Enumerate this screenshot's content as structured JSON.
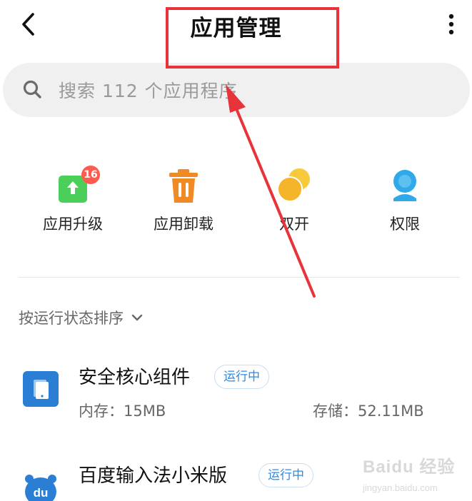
{
  "header": {
    "title": "应用管理"
  },
  "search": {
    "placeholder": "搜索 112 个应用程序"
  },
  "quick_actions": [
    {
      "label": "应用升级",
      "icon": "upgrade-icon",
      "badge": "16",
      "color": "#4ccf5a"
    },
    {
      "label": "应用卸载",
      "icon": "trash-icon",
      "color": "#f08a24"
    },
    {
      "label": "双开",
      "icon": "dual-app-icon",
      "color": "#f5b52a"
    },
    {
      "label": "权限",
      "icon": "permission-icon",
      "color": "#2fa9ea"
    }
  ],
  "sort": {
    "label": "按运行状态排序"
  },
  "apps": [
    {
      "name": "安全核心组件",
      "status": "运行中",
      "memory": "内存：15MB",
      "storage": "存储：52.11MB",
      "icon": "security-core-icon"
    },
    {
      "name": "百度输入法小米版",
      "status": "运行中",
      "icon": "baidu-input-icon"
    }
  ],
  "watermark": {
    "logo": "Baidu 经验",
    "url": "jingyan.baidu.com"
  },
  "colors": {
    "annotation": "#e8333a",
    "status_text": "#2f8ae0",
    "search_bg": "#f0f0f0"
  }
}
